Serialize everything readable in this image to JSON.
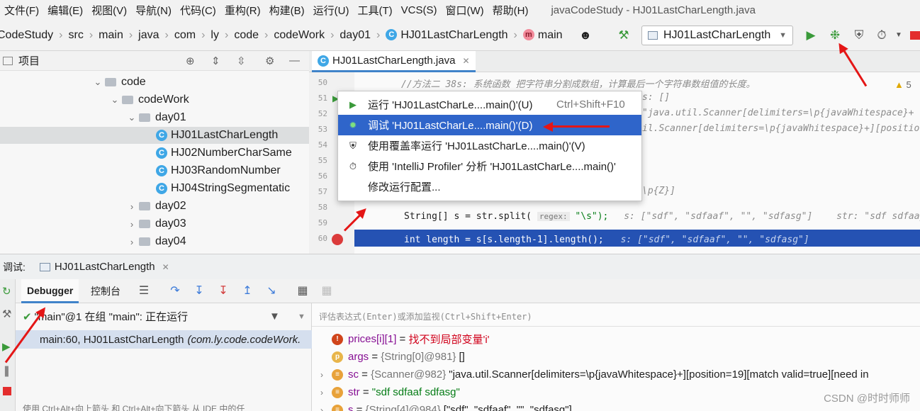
{
  "menu": [
    "文件(F)",
    "编辑(E)",
    "视图(V)",
    "导航(N)",
    "代码(C)",
    "重构(R)",
    "构建(B)",
    "运行(U)",
    "工具(T)",
    "VCS(S)",
    "窗口(W)",
    "帮助(H)"
  ],
  "window_title": "javaCodeStudy - HJ01LastCharLength.java",
  "breadcrumb": [
    "CodeStudy",
    "src",
    "main",
    "java",
    "com",
    "ly",
    "code",
    "codeWork",
    "day01",
    "HJ01LastCharLength",
    "main"
  ],
  "run_config": "HJ01LastCharLength",
  "icons": {
    "run": "run-icon",
    "debug": "debug-icon",
    "coverage": "coverage-icon",
    "profiler": "profiler-icon",
    "build": "hammer-icon",
    "user": "user-icon"
  },
  "project": {
    "title": "项目",
    "tree": [
      {
        "label": "code",
        "depth": 0,
        "kind": "folder",
        "expanded": true
      },
      {
        "label": "codeWork",
        "depth": 1,
        "kind": "folder",
        "expanded": true
      },
      {
        "label": "day01",
        "depth": 2,
        "kind": "folder",
        "expanded": true
      },
      {
        "label": "HJ01LastCharLength",
        "depth": 3,
        "kind": "class",
        "selected": true
      },
      {
        "label": "HJ02NumberCharSame",
        "depth": 3,
        "kind": "class"
      },
      {
        "label": "HJ03RandomNumber",
        "depth": 3,
        "kind": "class"
      },
      {
        "label": "HJ04StringSegmentatic",
        "depth": 3,
        "kind": "class"
      },
      {
        "label": "day02",
        "depth": 2,
        "kind": "folder",
        "expanded": false
      },
      {
        "label": "day03",
        "depth": 2,
        "kind": "folder",
        "expanded": false
      },
      {
        "label": "day04",
        "depth": 2,
        "kind": "folder",
        "expanded": false
      }
    ]
  },
  "editor": {
    "tab": "HJ01LastCharLength.java",
    "warning_count": "5",
    "lines": [
      {
        "n": "50",
        "text": "//方法二 38s: 系统函数 把字符串分割成数组，计算最后一个字符串数组值的长度。",
        "cls": "cmt"
      },
      {
        "n": "51",
        "text": "s: []",
        "cls": "hint"
      },
      {
        "n": "52",
        "text": "\"java.util.Scanner[delimiters=\\p{javaWhitespace}+",
        "cls": "hint"
      },
      {
        "n": "53",
        "text": "il.Scanner[delimiters=\\p{javaWhitespace}+][positio",
        "cls": "hint"
      },
      {
        "n": "54",
        "text": "",
        "cls": ""
      },
      {
        "n": "55",
        "text": "",
        "cls": ""
      },
      {
        "n": "56",
        "text": "",
        "cls": ""
      },
      {
        "n": "57",
        "text": "\\p{Z}]",
        "cls": "cmt"
      },
      {
        "n": "58",
        "text": "",
        "cls": ""
      },
      {
        "n": "59",
        "text": "",
        "cls": ""
      },
      {
        "n": "60",
        "text": "",
        "cls": ""
      }
    ],
    "line58": {
      "code": "String[] s = str.split(",
      "regex": "regex:",
      "arg": "\"\\s\");",
      "hint1": "s: [\"sdf\", \"sdfaaf\", \"\", \"sdfasg\"]",
      "hint2": "str: \"sdf sdfaaj"
    },
    "line60": {
      "code": "int length = s[s.length-1].length();",
      "hint": "s: [\"sdf\", \"sdfaaf\", \"\", \"sdfasg\"]"
    }
  },
  "context_menu": [
    {
      "icon": "run-icon",
      "label": "运行 'HJ01LastCharLe....main()'(U)",
      "shortcut": "Ctrl+Shift+F10",
      "selected": false
    },
    {
      "icon": "debug-icon",
      "label": "调试 'HJ01LastCharLe....main()'(D)",
      "shortcut": "",
      "selected": true
    },
    {
      "icon": "coverage-icon",
      "label": "使用覆盖率运行  'HJ01LastCharLe....main()'(V)",
      "shortcut": "",
      "selected": false
    },
    {
      "icon": "profiler-icon",
      "label": "使用 'IntelliJ Profiler' 分析  'HJ01LastCharLe....main()'",
      "shortcut": "",
      "selected": false
    },
    {
      "icon": "",
      "label": "修改运行配置...",
      "shortcut": "",
      "selected": false
    }
  ],
  "debug": {
    "label": "调试:",
    "session": "HJ01LastCharLength",
    "tabs": [
      "Debugger",
      "控制台"
    ],
    "thread": "\"main\"@1 在组 \"main\": 正在运行",
    "frame": "main:60, HJ01LastCharLength",
    "frame_pkg": "(com.ly.code.codeWork.",
    "eval_placeholder": "评估表达式(Enter)或添加监视(Ctrl+Shift+Enter)",
    "variables": [
      {
        "icon": "!",
        "icon_color": "#d0451b",
        "name": "prices[i][1]",
        "sep": " = ",
        "value": "找不到局部变量'i'",
        "vclass": "verr",
        "type": "",
        "expandable": false
      },
      {
        "icon": "p",
        "icon_color": "#e8b54a",
        "name": "args",
        "sep": " = ",
        "type": "{String[0]@981}",
        "value": "[]",
        "vclass": "",
        "expandable": false
      },
      {
        "icon": "≡",
        "icon_color": "#e8a23a",
        "name": "sc",
        "sep": " = ",
        "type": "{Scanner@982}",
        "value": "\"java.util.Scanner[delimiters=\\p{javaWhitespace}+][position=19][match valid=true][need in",
        "vclass": "",
        "expandable": true
      },
      {
        "icon": "≡",
        "icon_color": "#e8a23a",
        "name": "str",
        "sep": " = ",
        "type": "",
        "value": "\"sdf sdfaaf  sdfasg\"",
        "vclass": "vstr",
        "expandable": true
      },
      {
        "icon": "≡",
        "icon_color": "#e8a23a",
        "name": "s",
        "sep": " = ",
        "type": "{String[4]@984}",
        "value": "[\"sdf\", \"sdfaaf\", \"\", \"sdfasg\"]",
        "vclass": "",
        "expandable": true
      }
    ],
    "tip": "使用 Ctrl+Alt+向上箭头 和 Ctrl+Alt+向下箭头 从 IDE 中的任"
  },
  "watermark": "CSDN @时时师师"
}
